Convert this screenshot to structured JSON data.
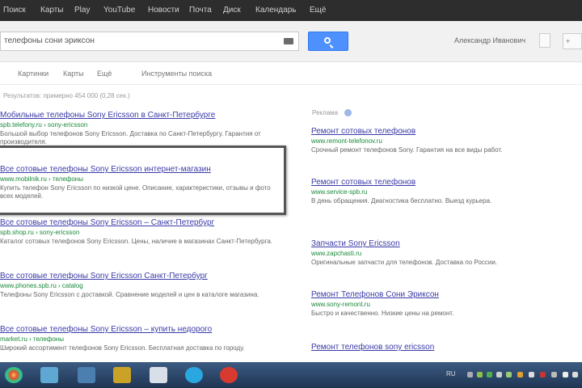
{
  "topbar": {
    "links": [
      "Поиск",
      "Карты",
      "Play",
      "YouTube",
      "Новости",
      "Почта",
      "Диск",
      "Календарь",
      "Ещё"
    ]
  },
  "search": {
    "query": "телефоны сони эриксон",
    "user": "Александр Иванович"
  },
  "tabs": [
    "Картинки",
    "Карты",
    "Ещё",
    "Инструменты поиска"
  ],
  "stats": "Результатов: примерно 454 000 (0,28 сек.)",
  "results": [
    {
      "title": "Мобильные телефоны Sony Ericsson в Санкт-Петербурге",
      "url": "spb.telefony.ru › sony-ericsson",
      "snippet": "Большой выбор телефонов Sony Ericsson. Доставка по Санкт-Петербургу. Гарантия от производителя."
    },
    {
      "title": "Все сотовые телефоны Sony Ericsson интернет-магазин",
      "url": "www.mobilnik.ru › телефоны",
      "snippet": "Купить телефон Sony Ericsson по низкой цене. Описание, характеристики, отзывы и фото всех моделей."
    },
    {
      "title": "Все сотовые телефоны Sony Ericsson – Санкт-Петербург",
      "url": "spb.shop.ru › sony-ericsson",
      "snippet": "Каталог сотовых телефонов Sony Ericsson. Цены, наличие в магазинах Санкт-Петербурга."
    },
    {
      "title": "Все сотовые телефоны Sony Ericsson Санкт-Петербург",
      "url": "www.phones.spb.ru › catalog",
      "snippet": "Телефоны Sony Ericsson с доставкой. Сравнение моделей и цен в каталоге магазина."
    },
    {
      "title": "Все сотовые телефоны Sony Ericsson – купить недорого",
      "url": "market.ru › телефоны",
      "snippet": "Широкий ассортимент телефонов Sony Ericsson. Бесплатная доставка по городу."
    }
  ],
  "ads": {
    "label": "Реклама",
    "items": [
      {
        "title": "Ремонт сотовых телефонов",
        "url": "www.remont-telefonov.ru",
        "snippet": "Срочный ремонт телефонов Sony. Гарантия на все виды работ."
      },
      {
        "title": "Ремонт сотовых телефонов",
        "url": "www.service-spb.ru",
        "snippet": "В день обращения. Диагностика бесплатно. Выезд курьера."
      },
      {
        "title": "Запчасти Sony Ericsson",
        "url": "www.zapchasti.ru",
        "snippet": "Оригинальные запчасти для телефонов. Доставка по России."
      },
      {
        "title": "Ремонт Телефонов Сони Эриксон",
        "url": "www.sony-remont.ru",
        "snippet": "Быстро и качественно. Низкие цены на ремонт."
      },
      {
        "title": "Ремонт телефонов sony ericsson",
        "url": "",
        "snippet": ""
      }
    ]
  },
  "taskbar": {
    "tray_text": "RU"
  }
}
